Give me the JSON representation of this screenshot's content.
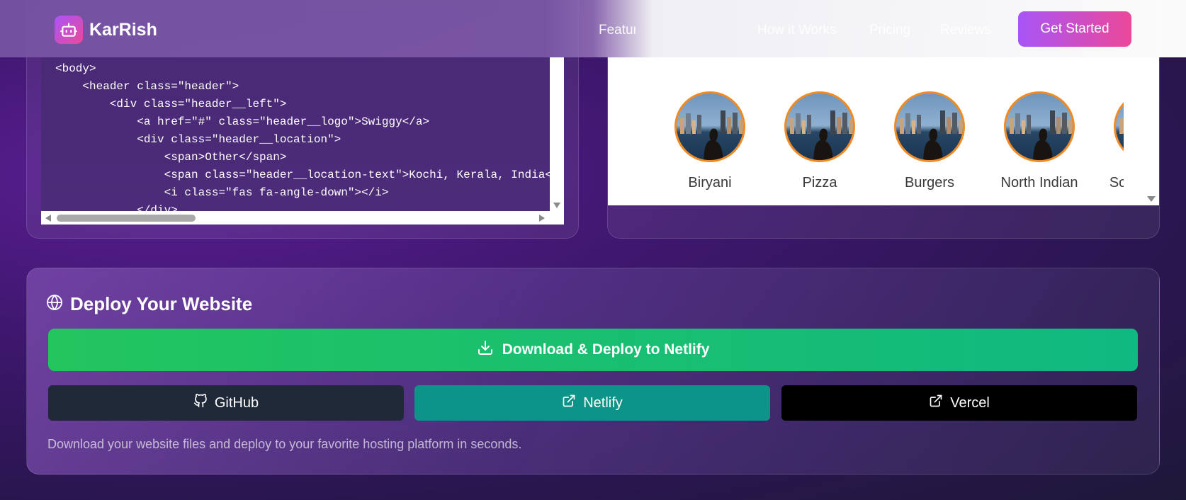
{
  "nav": {
    "brand": "KarRish",
    "links": [
      "Features",
      "How it Works",
      "Pricing",
      "Reviews"
    ],
    "cta_label": "Get Started"
  },
  "code_panel": {
    "lines": [
      "<body>",
      "    <header class=\"header\">",
      "        <div class=\"header__left\">",
      "            <a href=\"#\" class=\"header__logo\">Swiggy</a>",
      "            <div class=\"header__location\">",
      "                <span>Other</span>",
      "                <span class=\"header__location-text\">Kochi, Kerala, India</span>",
      "                <i class=\"fas fa-angle-down\"></i>",
      "            </div>"
    ]
  },
  "preview": {
    "categories": [
      {
        "label": "Biryani"
      },
      {
        "label": "Pizza"
      },
      {
        "label": "Burgers"
      },
      {
        "label": "North Indian"
      },
      {
        "label": "South Indian"
      }
    ]
  },
  "deploy": {
    "icon": "globe-icon",
    "title": "Deploy Your Website",
    "main_button": "Download & Deploy to Netlify",
    "github_label": "GitHub",
    "netlify_label": "Netlify",
    "vercel_label": "Vercel",
    "note": "Download your website files and deploy to your favorite hosting platform in seconds.",
    "colors": {
      "main_button": "#22c55e",
      "github_button": "#202938",
      "netlify_button": "#0d9488",
      "vercel_button": "#000000"
    }
  }
}
